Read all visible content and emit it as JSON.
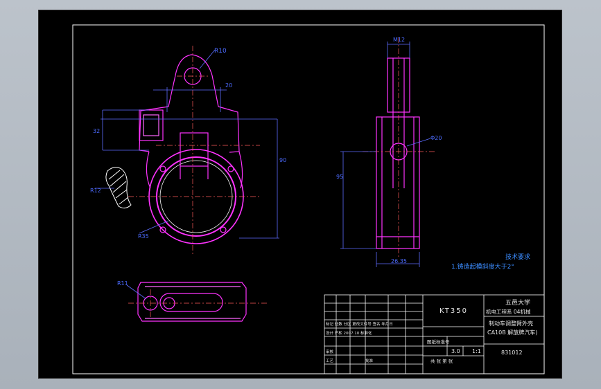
{
  "drawing": {
    "title_block": {
      "university": "五邑大学",
      "class_info": "机电工程系 04机械",
      "model": "KT350",
      "part_name_line1": "制动车调整臂外壳",
      "part_name_line2": "CA10B  解放牌汽车)",
      "drawing_no": "831012",
      "material_label": "图纸标准号",
      "scale": "1:1",
      "weight": "3.0",
      "sheet_label": "共  张  第  张",
      "revision_row": "标记 处数 分区 更改文件号 签名 年月日",
      "design_row": "设计 严松 2007.10 标准化",
      "check_row": "审核",
      "process_row": "工艺",
      "approve_row": "批准"
    },
    "notes": {
      "title": "技术要求",
      "item1": "1.铸造起模斜度大于2°"
    },
    "dimensions": {
      "d_top": "R10",
      "d_side_width": "20",
      "d_height": "90",
      "d_left": "32",
      "d_r_edge": "R12",
      "d_bottom": "R35",
      "d_side_top": "M12",
      "d_side_bore": "Φ20",
      "d_side_height": "95",
      "d_side_bottom": "26.35",
      "d_bottom_view": "R11"
    }
  }
}
